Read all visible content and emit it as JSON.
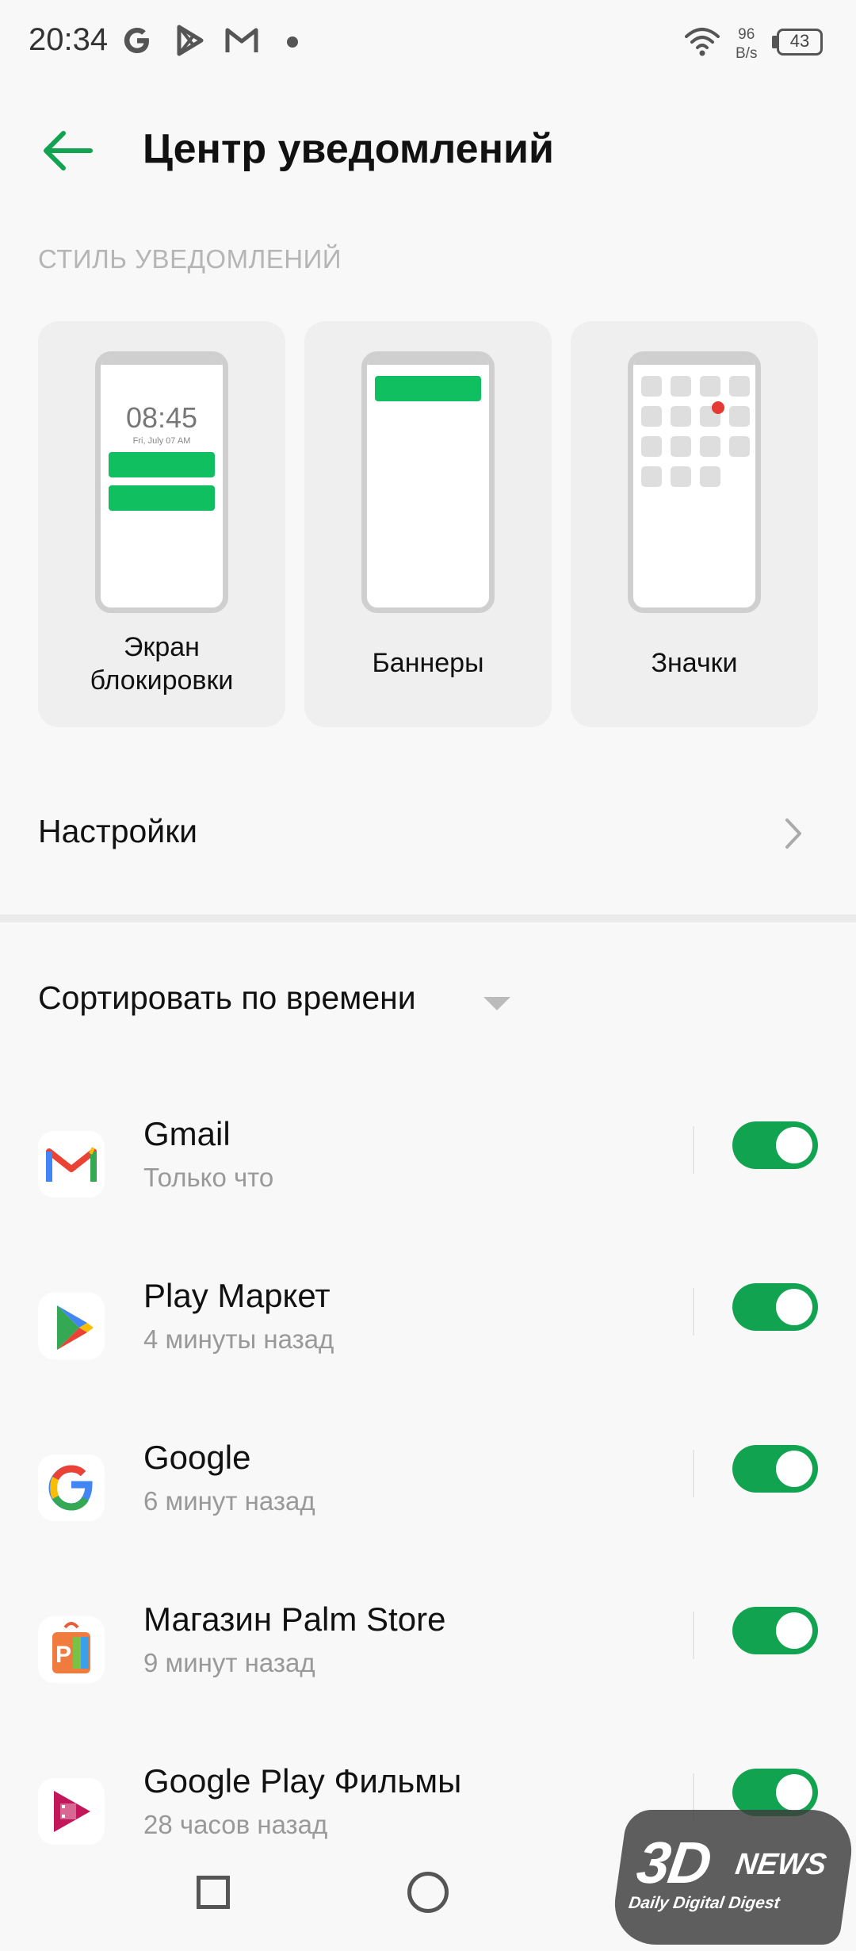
{
  "status_bar": {
    "time": "20:34",
    "speed_value": "96",
    "speed_unit": "B/s",
    "battery": "43",
    "icons": [
      "google-g-icon",
      "play-store-icon",
      "gmail-icon",
      "notification-dot-icon",
      "wifi-icon",
      "battery-icon"
    ]
  },
  "header": {
    "title": "Центр уведомлений",
    "back_icon": "arrow-left-icon"
  },
  "notification_style": {
    "caption": "СТИЛЬ УВЕДОМЛЕНИЙ",
    "cards": [
      {
        "label_line1": "Экран",
        "label_line2": "блокировки",
        "preview_time": "08:45",
        "preview_date": "Fri, July 07 AM"
      },
      {
        "label": "Баннеры"
      },
      {
        "label": "Значки"
      }
    ]
  },
  "settings": {
    "label": "Настройки"
  },
  "sort": {
    "label": "Сортировать по времени"
  },
  "apps": [
    {
      "name": "Gmail",
      "time": "Только что",
      "enabled": true,
      "icon": "gmail-icon"
    },
    {
      "name": "Play Маркет",
      "time": "4 минуты назад",
      "enabled": true,
      "icon": "play-store-icon"
    },
    {
      "name": "Google",
      "time": "6 минут назад",
      "enabled": true,
      "icon": "google-g-icon"
    },
    {
      "name": "Магазин Palm Store",
      "time": "9 минут назад",
      "enabled": true,
      "icon": "palm-store-icon"
    },
    {
      "name": "Google Play Фильмы",
      "time": "28 часов назад",
      "enabled": true,
      "icon": "play-movies-icon"
    }
  ],
  "watermark": {
    "main": "3D",
    "news": "NEWS",
    "sub": "Daily Digital Digest"
  },
  "colors": {
    "accent_green": "#12a351",
    "preview_green": "#10c060",
    "badge_red": "#e53935"
  }
}
